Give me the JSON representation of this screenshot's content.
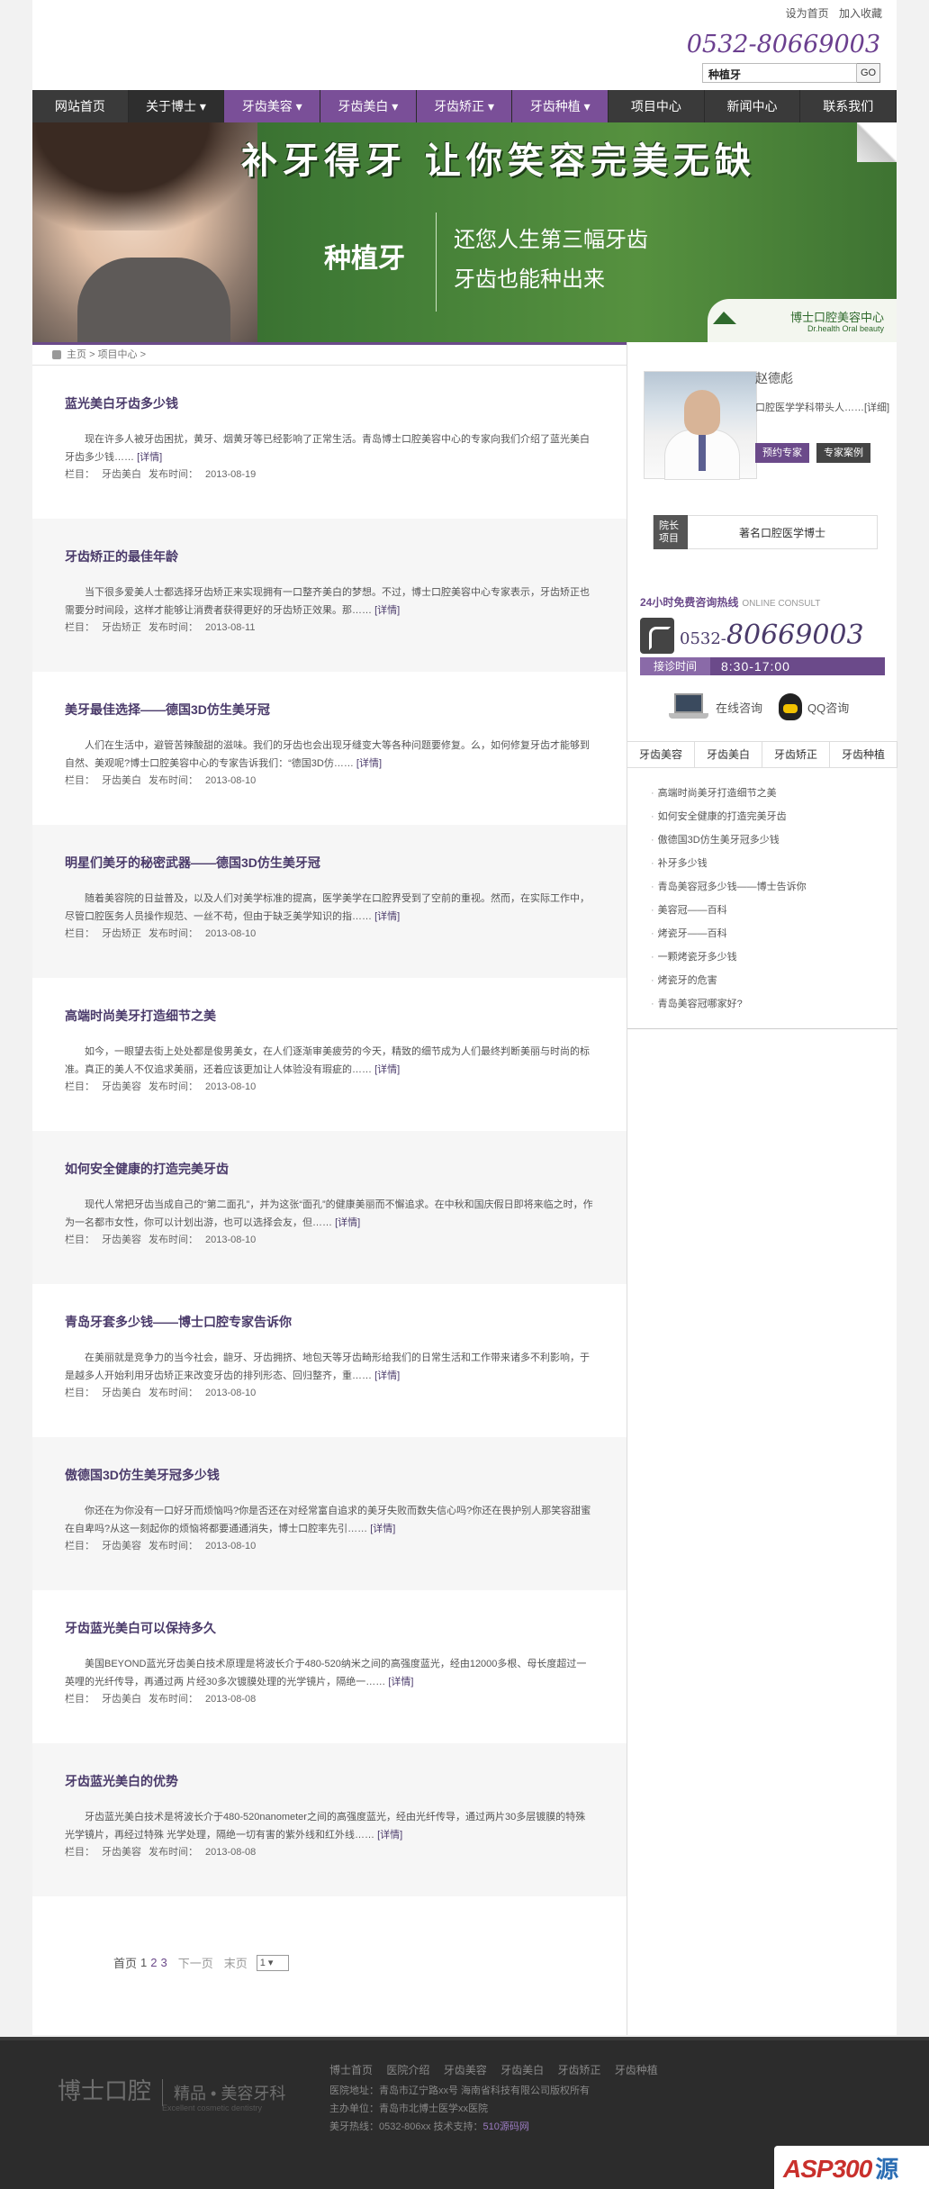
{
  "top": {
    "links": [
      "设为首页",
      "加入收藏"
    ],
    "hotline": "0532-80669003",
    "search_value": "种植牙",
    "search_button": "GO"
  },
  "nav": [
    {
      "label": "网站首页",
      "style": "normal"
    },
    {
      "label": "关于博士 ▾",
      "style": "dark"
    },
    {
      "label": "牙齿美容 ▾",
      "style": "purple"
    },
    {
      "label": "牙齿美白 ▾",
      "style": "purple"
    },
    {
      "label": "牙齿矫正 ▾",
      "style": "purple"
    },
    {
      "label": "牙齿种植 ▾",
      "style": "purple"
    },
    {
      "label": "项目中心",
      "style": "normal"
    },
    {
      "label": "新闻中心",
      "style": "normal"
    },
    {
      "label": "联系我们",
      "style": "normal"
    }
  ],
  "banner": {
    "slogan": "补牙得牙 让你笑容完美无缺",
    "product": "种植牙",
    "line1": "还您人生第三幅牙齿",
    "line2": "牙齿也能种出来",
    "logo_cn": "博士口腔美容中心",
    "logo_en": "Dr.health Oral beauty"
  },
  "breadcrumb": {
    "home": "主页",
    "sep1": ">",
    "section": "项目中心",
    "sep2": ">"
  },
  "articles": [
    {
      "title": "蓝光美白牙齿多少钱",
      "excerpt": "现在许多人被牙齿困扰，黄牙、烟黄牙等已经影响了正常生活。青岛博士口腔美容中心的专家向我们介绍了蓝光美白牙齿多少钱……",
      "more": "[详情]",
      "cat_label": "栏目：",
      "cat": "牙齿美白",
      "date_label": "发布时间：",
      "date": "2013-08-19"
    },
    {
      "title": "牙齿矫正的最佳年龄",
      "excerpt": "当下很多爱美人士都选择牙齿矫正来实现拥有一口整齐美白的梦想。不过，博士口腔美容中心专家表示，牙齿矫正也需要分时间段，这样才能够让消费者获得更好的牙齿矫正效果。那……",
      "more": "[详情]",
      "cat_label": "栏目：",
      "cat": "牙齿矫正",
      "date_label": "发布时间：",
      "date": "2013-08-11"
    },
    {
      "title": "美牙最佳选择——德国3D仿生美牙冠",
      "excerpt": "人们在生活中，避管苦辣酸甜的滋味。我们的牙齿也会出现牙缝变大等各种问题要修复。么，如何修复牙齿才能够到自然、美观呢?博士口腔美容中心的专家告诉我们：“德国3D仿……",
      "more": "[详情]",
      "cat_label": "栏目：",
      "cat": "牙齿美白",
      "date_label": "发布时间：",
      "date": "2013-08-10"
    },
    {
      "title": "明星们美牙的秘密武器——德国3D仿生美牙冠",
      "excerpt": "随着美容院的日益普及，以及人们对美学标准的提高，医学美学在口腔界受到了空前的重视。然而，在实际工作中，尽管口腔医务人员操作规范、一丝不苟，但由于缺乏美学知识的指……",
      "more": "[详情]",
      "cat_label": "栏目：",
      "cat": "牙齿矫正",
      "date_label": "发布时间：",
      "date": "2013-08-10"
    },
    {
      "title": "高端时尚美牙打造细节之美",
      "excerpt": "如今，一眼望去街上处处都是俊男美女，在人们逐渐审美疲劳的今天，精致的细节成为人们最终判断美丽与时尚的标准。真正的美人不仅追求美丽，还着应该更加让人体验没有瑕疵的……",
      "more": "[详情]",
      "cat_label": "栏目：",
      "cat": "牙齿美容",
      "date_label": "发布时间：",
      "date": "2013-08-10"
    },
    {
      "title": "如何安全健康的打造完美牙齿",
      "excerpt": "现代人常把牙齿当成自己的“第二面孔”，并为这张“面孔”的健康美丽而不懈追求。在中秋和国庆假日即将来临之时，作为一名都市女性，你可以计划出游，也可以选择会友，但……",
      "more": "[详情]",
      "cat_label": "栏目：",
      "cat": "牙齿美容",
      "date_label": "发布时间：",
      "date": "2013-08-10"
    },
    {
      "title": "青岛牙套多少钱——博士口腔专家告诉你",
      "excerpt": "在美丽就是竞争力的当今社会，龅牙、牙齿拥挤、地包天等牙齿畸形给我们的日常生活和工作带来诸多不利影响，于是越多人开始利用牙齿矫正来改变牙齿的排列形态、回归整齐，重……",
      "more": "[详情]",
      "cat_label": "栏目：",
      "cat": "牙齿美白",
      "date_label": "发布时间：",
      "date": "2013-08-10"
    },
    {
      "title": "傲德国3D仿生美牙冠多少钱",
      "excerpt": "你还在为你没有一口好牙而烦恼吗?你是否还在对经常富自追求的美牙失败而数失信心吗?你还在畏护别人那笑容甜蜜在自卑吗?从这一刻起你的烦恼将都要通通消失，博士口腔率先引……",
      "more": "[详情]",
      "cat_label": "栏目：",
      "cat": "牙齿美容",
      "date_label": "发布时间：",
      "date": "2013-08-10"
    },
    {
      "title": "牙齿蓝光美白可以保持多久",
      "excerpt": "美国BEYOND蓝光牙齿美白技术原理是将波长介于480-520纳米之间的高强度蓝光，经由12000多根、母长度超过一英哩的光纤传导，再通过两 片经30多次镀膜处理的光学镜片，隔绝一……",
      "more": "[详情]",
      "cat_label": "栏目：",
      "cat": "牙齿美白",
      "date_label": "发布时间：",
      "date": "2013-08-08"
    },
    {
      "title": "牙齿蓝光美白的优势",
      "excerpt": "牙齿蓝光美白技术是将波长介于480-520nanometer之间的高强度蓝光，经由光纤传导，通过两片30多层镀膜的特殊光学镜片，再经过特殊 光学处理，隔绝一切有害的紫外线和红外线……",
      "more": "[详情]",
      "cat_label": "栏目：",
      "cat": "牙齿美容",
      "date_label": "发布时间：",
      "date": "2013-08-08"
    }
  ],
  "pager": {
    "first": "首页",
    "current": "1",
    "p2": "2",
    "p3": "3",
    "next": "下一页",
    "last": "末页",
    "select": "1 ▾"
  },
  "sidebar": {
    "doctor_name": "赵德彪",
    "doctor_title": "口腔医学学科带头人……[详细]",
    "btn_book": "预约专家",
    "btn_cases": "专家案例",
    "director_label": "院长项目",
    "director_value": "著名口腔医学博士",
    "hotline_title": "24小时免费咨询热线",
    "hotline_en": "ONLINE CONSULT",
    "tel_prefix": "0532-",
    "tel_main": "80669003",
    "hours_label": "接诊时间",
    "hours_value": "8:30-17:00",
    "online_label": "在线咨询",
    "qq_label": "QQ咨询",
    "tabs": [
      "牙齿美容",
      "牙齿美白",
      "牙齿矫正",
      "牙齿种植"
    ],
    "list": [
      "高端时尚美牙打造细节之美",
      "如何安全健康的打造完美牙齿",
      "傲德国3D仿生美牙冠多少钱",
      "补牙多少钱",
      "青岛美容冠多少钱——博士告诉你",
      "美容冠——百科",
      "烤瓷牙——百科",
      "一颗烤瓷牙多少钱",
      "烤瓷牙的危害",
      "青岛美容冠哪家好?"
    ]
  },
  "footer": {
    "logo_main": "博士口腔",
    "logo_sub": "精品 • 美容牙科",
    "logo_en": "Excellent cosmetic dentistry",
    "links": [
      "博士首页",
      "医院介绍",
      "牙齿美容",
      "牙齿美白",
      "牙齿矫正",
      "牙齿种植"
    ],
    "address": "医院地址：青岛市辽宁路xx号  海南省科技有限公司版权所有",
    "sponsor": "主办单位：青岛市北博士医学xx医院",
    "tel": "美牙热线：0532-806xx  技术支持：",
    "tech": "510源码网",
    "badge_a": "ASP300",
    "badge_b": "源码"
  }
}
